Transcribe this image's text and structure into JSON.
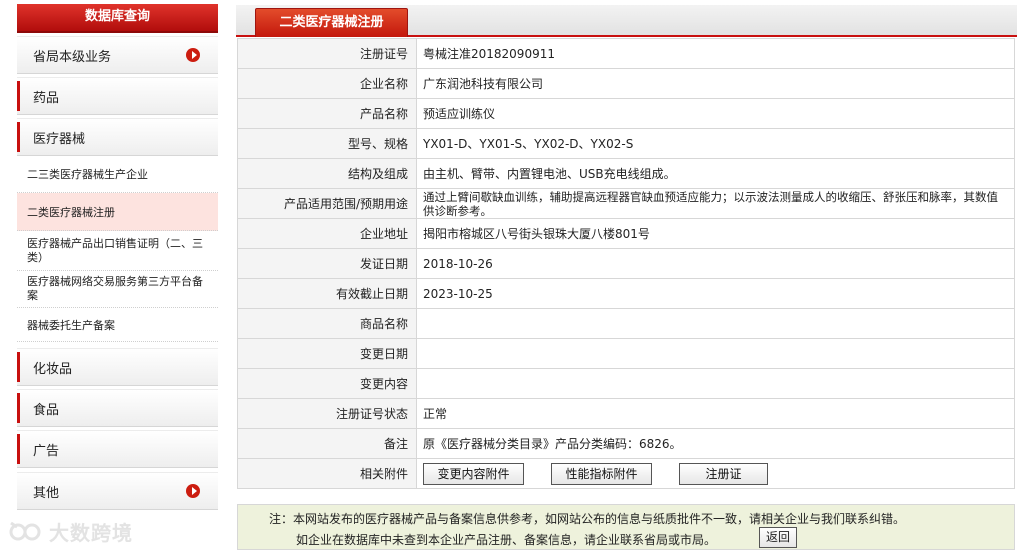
{
  "sidebar": {
    "title": "数据库查询",
    "items_top": [
      {
        "label": "省局本级业务",
        "arrow": true
      },
      {
        "label": "药品",
        "arrow": false
      },
      {
        "label": "医疗器械",
        "arrow": false
      }
    ],
    "sub_items": [
      {
        "label": "二三类医疗器械生产企业",
        "active": false
      },
      {
        "label": "二类医疗器械注册",
        "active": true
      },
      {
        "label": "医疗器械产品出口销售证明（二、三类）",
        "active": false
      },
      {
        "label": "医疗器械网络交易服务第三方平台备案",
        "active": false
      },
      {
        "label": "器械委托生产备案",
        "active": false
      }
    ],
    "items_bottom": [
      {
        "label": "化妆品",
        "arrow": false
      },
      {
        "label": "食品",
        "arrow": false
      },
      {
        "label": "广告",
        "arrow": false
      },
      {
        "label": "其他",
        "arrow": true
      }
    ]
  },
  "main": {
    "tab_title": "二类医疗器械注册",
    "rows": [
      {
        "key": "注册证号",
        "value": "粤械注准20182090911"
      },
      {
        "key": "企业名称",
        "value": "广东润池科技有限公司"
      },
      {
        "key": "产品名称",
        "value": "预适应训练仪"
      },
      {
        "key": "型号、规格",
        "value": "YX01-D、YX01-S、YX02-D、YX02-S"
      },
      {
        "key": "结构及组成",
        "value": "由主机、臂带、内置锂电池、USB充电线组成。"
      },
      {
        "key": "产品适用范围/预期用途",
        "value": "通过上臂间歇缺血训练，辅助提高远程器官缺血预适应能力；以示波法测量成人的收缩压、舒张压和脉率，其数值供诊断参考。"
      },
      {
        "key": "企业地址",
        "value": "揭阳市榕城区八号街头银珠大厦八楼801号"
      },
      {
        "key": "发证日期",
        "value": "2018-10-26"
      },
      {
        "key": "有效截止日期",
        "value": "2023-10-25"
      },
      {
        "key": "商品名称",
        "value": ""
      },
      {
        "key": "变更日期",
        "value": ""
      },
      {
        "key": "变更内容",
        "value": ""
      },
      {
        "key": "注册证号状态",
        "value": "正常"
      },
      {
        "key": "备注",
        "value": "原《医疗器械分类目录》产品分类编码：6826。"
      }
    ],
    "attachments_label": "相关附件",
    "attachments": [
      "变更内容附件",
      "性能指标附件",
      "注册证"
    ],
    "note_line1": "注：本网站发布的医疗器械产品与备案信息供参考，如网站公布的信息与纸质批件不一致，请相关企业与我们联系纠错。",
    "note_line2": "如企业在数据库中未查到本企业产品注册、备案信息，请企业联系省局或市局。",
    "back_label": "返回"
  },
  "watermark": {
    "text": "大数跨境",
    "icon": "watermark-logo-icon"
  },
  "colors": {
    "accent_red": "#c8100f",
    "note_bg": "#eef2dc",
    "active_sub_bg": "#fde3df"
  }
}
